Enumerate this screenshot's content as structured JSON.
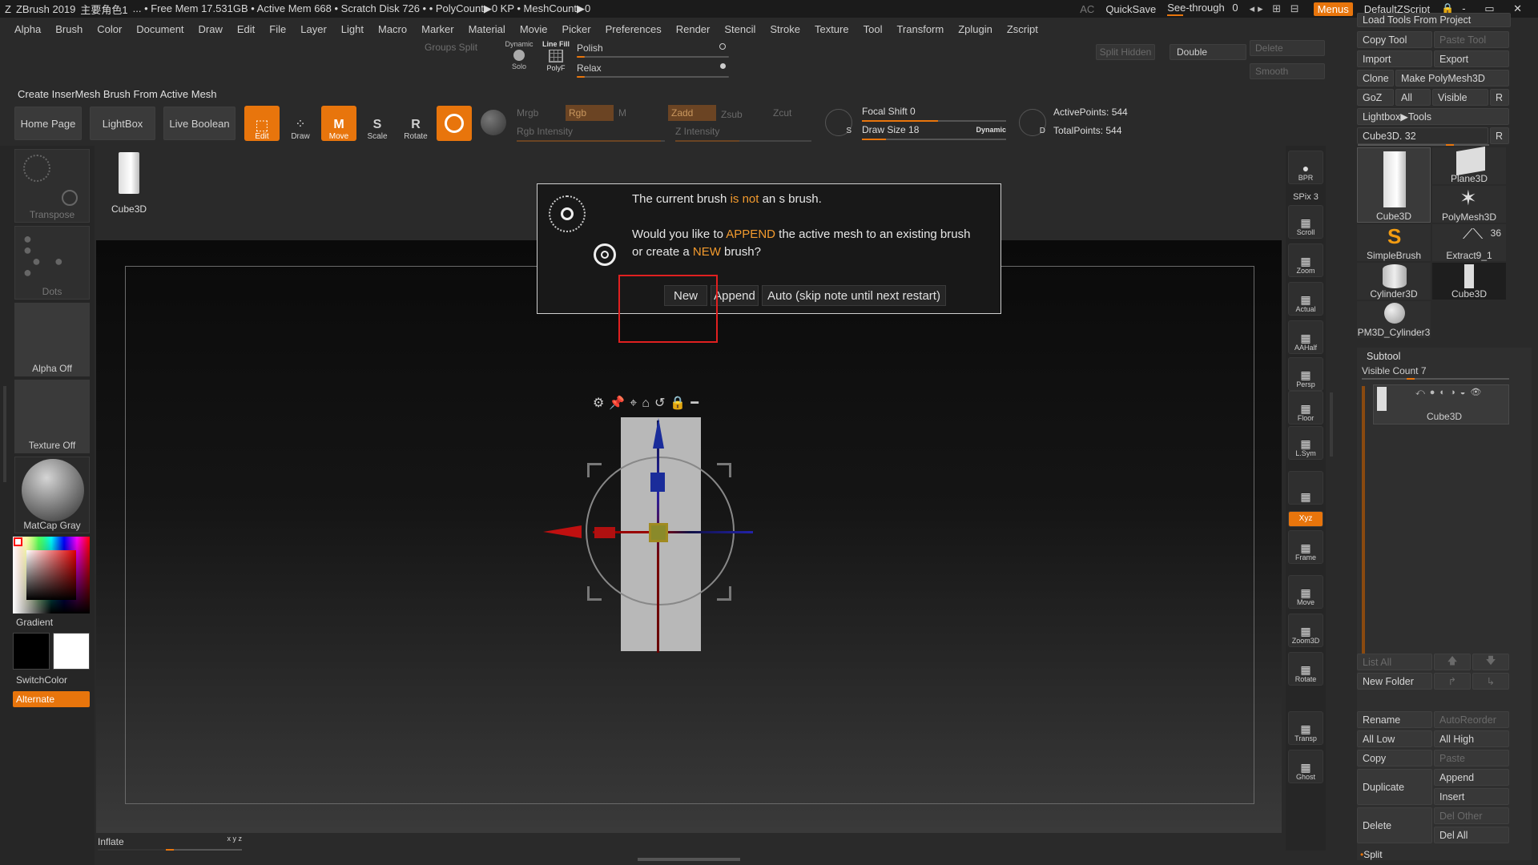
{
  "titlebar": {
    "app": "ZBrush 2019",
    "project": "主要角色1",
    "stats": "... • Free Mem 17.531GB • Active Mem 668 • Scratch Disk 726 •  • PolyCount▶0 KP  • MeshCount▶0",
    "ac": "AC",
    "quicksave": "QuickSave",
    "see_through": "See-through",
    "see_through_value": "0",
    "menus": "Menus",
    "script": "DefaultZScript"
  },
  "menubar": [
    "Alpha",
    "Brush",
    "Color",
    "Document",
    "Draw",
    "Edit",
    "File",
    "Layer",
    "Light",
    "Macro",
    "Marker",
    "Material",
    "Movie",
    "Picker",
    "Preferences",
    "Render",
    "Stencil",
    "Stroke",
    "Texture",
    "Tool",
    "Transform",
    "Zplugin",
    "Zscript"
  ],
  "top_controls": {
    "groups_split": "Groups Split",
    "dynamic": "Dynamic",
    "solo": "Solo",
    "line_fill": "Line Fill",
    "polyf": "PolyF",
    "polish": "Polish",
    "relax": "Relax",
    "split_hidden": "Split Hidden",
    "double": "Double",
    "delete": "Delete",
    "smooth": "Smooth"
  },
  "status_note": "Create InserMesh Brush From Active Mesh",
  "shelf": {
    "home_page": "Home Page",
    "lightbox": "LightBox",
    "live_boolean": "Live Boolean",
    "edit": "Edit",
    "draw": "Draw",
    "move": "Move",
    "scale": "Scale",
    "rotate": "Rotate",
    "mrgb": "Mrgb",
    "rgb": "Rgb",
    "m": "M",
    "rgb_intensity": "Rgb Intensity",
    "zadd": "Zadd",
    "zsub": "Zsub",
    "zcut": "Zcut",
    "z_intensity": "Z Intensity",
    "focal_shift": "Focal Shift 0",
    "draw_size": "Draw Size 18",
    "dynamic": "Dynamic",
    "active_points": "ActivePoints: 544",
    "total_points": "TotalPoints: 544",
    "tool_name": "Cube3D"
  },
  "left_panel": {
    "transpose": "Transpose",
    "dots": "Dots",
    "alpha_off": "Alpha Off",
    "texture_off": "Texture Off",
    "matcap": "MatCap Gray",
    "gradient": "Gradient",
    "switchcolor": "SwitchColor",
    "alternate": "Alternate"
  },
  "right_strip": [
    "BPR",
    "SPix 3",
    "Scroll",
    "Zoom",
    "Actual",
    "AAHalf",
    "Persp",
    "Floor",
    "L.Sym",
    "",
    "Xyz",
    "Frame",
    "Move",
    "Zoom3D",
    "Rotate",
    "Transp",
    "Ghost"
  ],
  "right_panel": {
    "load_tools": "Load Tools From Project",
    "copy_tool": "Copy Tool",
    "paste_tool": "Paste Tool",
    "import": "Import",
    "export": "Export",
    "clone": "Clone",
    "make_polymesh": "Make PolyMesh3D",
    "goz": "GoZ",
    "all": "All",
    "visible": "Visible",
    "r": "R",
    "lightbox_tools": "Lightbox▶Tools",
    "cube_slider": "Cube3D. 32",
    "tools": [
      "Cube3D",
      "Plane3D",
      "PolyMesh3D",
      "SimpleBrush",
      "Extract9_1",
      "Cylinder3D",
      "Cube3D",
      "PM3D_Cylinder3"
    ],
    "extract_count": "36",
    "subtool": "Subtool",
    "visible_count": "Visible Count 7",
    "subtool_item": "Cube3D",
    "list_all": "List All",
    "new_folder": "New Folder",
    "rename": "Rename",
    "autoreorder": "AutoReorder",
    "all_low": "All Low",
    "all_high": "All High",
    "copy": "Copy",
    "paste": "Paste",
    "duplicate": "Duplicate",
    "append": "Append",
    "insert": "Insert",
    "delete": "Delete",
    "del_other": "Del Other",
    "del_all": "Del All",
    "split": "Split"
  },
  "canvas": {
    "inflate": "Inflate",
    "xyz_label": "x y z"
  },
  "dialog": {
    "line1_pre": "The current brush ",
    "line1_hl": "is not",
    "line1_post": " an s brush.",
    "line2_pre": "Would you like to ",
    "line2_hl": "APPEND",
    "line2_post": " the active mesh to an existing brush",
    "line3_pre": "or create a ",
    "line3_hl": "NEW",
    "line3_post": " brush?",
    "btn_new": "New",
    "btn_append": "Append",
    "btn_auto": "Auto (skip note until next restart)"
  },
  "colors": {
    "accent": "#e8750c",
    "highlight_box": "#e02020"
  }
}
